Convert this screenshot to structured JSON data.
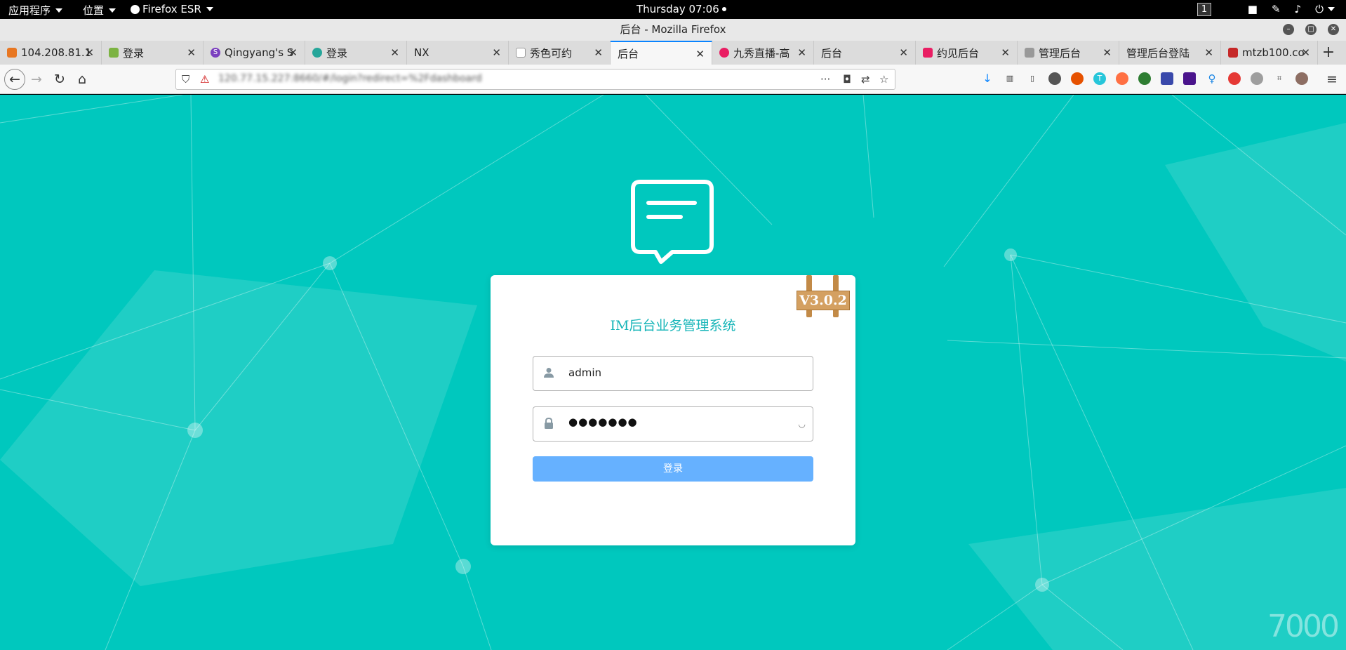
{
  "system_bar": {
    "apps_menu": "应用程序",
    "places_menu": "位置",
    "active_app": "Firefox ESR",
    "clock": "Thursday 07:06",
    "workspace": "1"
  },
  "window": {
    "title": "后台 - Mozilla Firefox"
  },
  "tabs": [
    {
      "label": "104.208.81.1",
      "favicon_color": "#e87722"
    },
    {
      "label": "登录",
      "favicon_color": "#7cb342"
    },
    {
      "label": "Qingyang's S",
      "favicon_color": "#7b3fbf"
    },
    {
      "label": "登录",
      "favicon_color": "#26a69a"
    },
    {
      "label": "NX",
      "favicon_color": ""
    },
    {
      "label": "秀色可约",
      "favicon_color": "#333333"
    },
    {
      "label": "后台",
      "favicon_color": "",
      "active": true
    },
    {
      "label": "九秀直播-高",
      "favicon_color": "#e91e63"
    },
    {
      "label": "后台",
      "favicon_color": ""
    },
    {
      "label": "约见后台",
      "favicon_color": "#e91e63"
    },
    {
      "label": "管理后台",
      "favicon_color": "#999999"
    },
    {
      "label": "管理后台登陆",
      "favicon_color": ""
    },
    {
      "label": "mtzb100.co",
      "favicon_color": "#c62828"
    }
  ],
  "url_bar": {
    "url": "120.77.15.227:8660/#/login?redirect=%2Fdashboard"
  },
  "login": {
    "title": "IM后台业务管理系统",
    "version": "V3.0.2",
    "username_value": "admin",
    "password_value": "●●●●●●●",
    "login_button": "登录"
  },
  "watermark": "7000",
  "colors": {
    "page_background": "#00c8be",
    "title_color": "#16b5b8",
    "button_color": "#66b1ff"
  }
}
